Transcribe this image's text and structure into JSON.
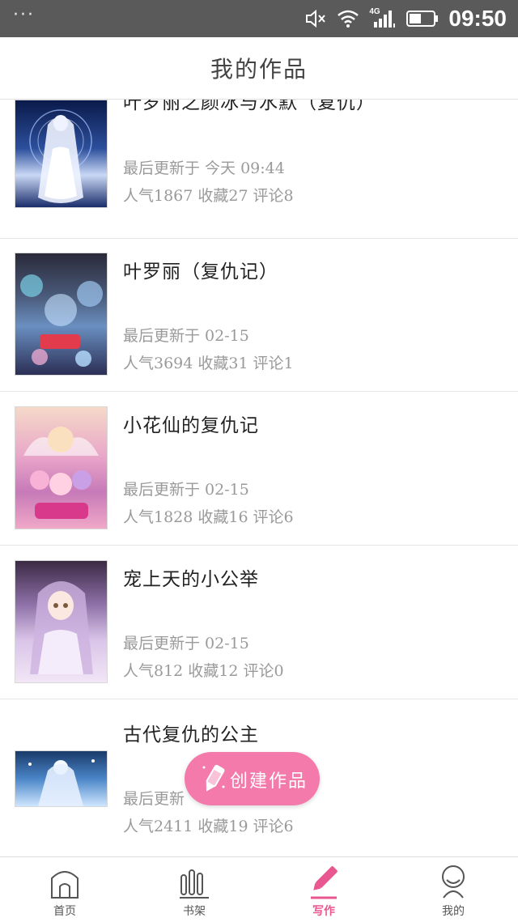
{
  "status_bar": {
    "left_indicator": "···",
    "network": "4G",
    "time": "09:50"
  },
  "header": {
    "title": "我的作品"
  },
  "works": [
    {
      "title": "叶罗丽之颜冰与水默（复仇）",
      "updated": "最后更新于 今天 09:44",
      "popularity": "人气1867",
      "favorites": "收藏27",
      "comments": "评论8"
    },
    {
      "title": "叶罗丽（复仇记）",
      "updated": "最后更新于 02-15",
      "popularity": "人气3694",
      "favorites": "收藏31",
      "comments": "评论1"
    },
    {
      "title": "小花仙的复仇记",
      "updated": "最后更新于 02-15",
      "popularity": "人气1828",
      "favorites": "收藏16",
      "comments": "评论6"
    },
    {
      "title": "宠上天的小公举",
      "updated": "最后更新于 02-15",
      "popularity": "人气812",
      "favorites": "收藏12",
      "comments": "评论0"
    },
    {
      "title": "古代复仇的公主",
      "updated": "最后更新",
      "popularity": "人气2411",
      "favorites": "收藏19",
      "comments": "评论6"
    }
  ],
  "fab": {
    "label": "创建作品",
    "icon": "pencil-icon"
  },
  "bottom_nav": [
    {
      "label": "首页",
      "icon": "home-icon"
    },
    {
      "label": "书架",
      "icon": "bookshelf-icon"
    },
    {
      "label": "写作",
      "icon": "pencil-icon",
      "active": true
    },
    {
      "label": "我的",
      "icon": "user-icon"
    }
  ],
  "colors": {
    "accent": "#e8578f",
    "fab": "#f37aab",
    "status_bar": "#5a5a5a"
  }
}
